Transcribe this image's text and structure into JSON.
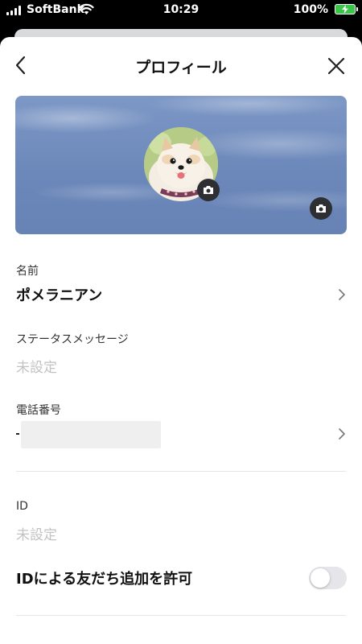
{
  "status_bar": {
    "carrier": "SoftBank",
    "time": "10:29",
    "battery_percent": "100%",
    "battery_color": "#3ac747"
  },
  "header": {
    "title": "プロフィール",
    "back_icon": "chevron-left-icon",
    "close_icon": "close-icon"
  },
  "cover": {
    "sky_color": "#6c88ba",
    "avatar_alt": "pomeranian-photo",
    "camera_icon": "camera-icon"
  },
  "fields": {
    "name": {
      "label": "名前",
      "value": "ポメラニアン"
    },
    "status_message": {
      "label": "ステータスメッセージ",
      "value": "未設定"
    },
    "phone": {
      "label": "電話番号",
      "value": "-"
    },
    "id": {
      "label": "ID",
      "value": "未設定"
    },
    "id_friend_add": {
      "label": "IDによる友だち追加を許可",
      "enabled": false
    }
  }
}
